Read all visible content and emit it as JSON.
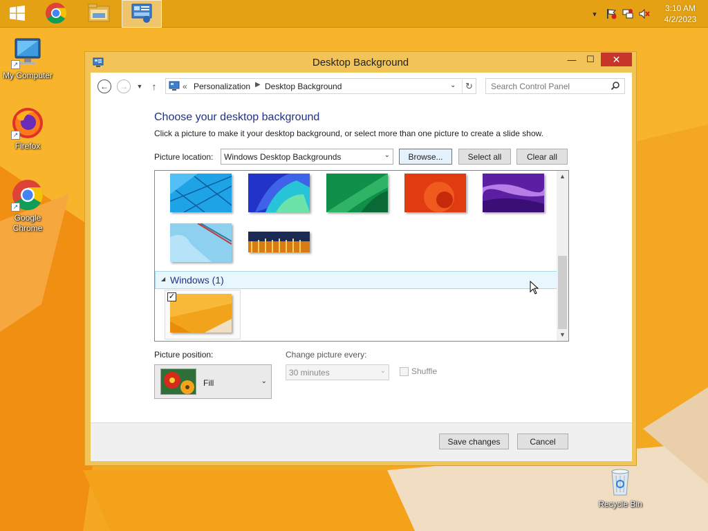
{
  "taskbar": {
    "items": [
      {
        "name": "start",
        "icon": "windows-logo-icon"
      },
      {
        "name": "chrome",
        "icon": "chrome-icon"
      },
      {
        "name": "file-explorer",
        "icon": "folder-icon"
      },
      {
        "name": "control-panel",
        "icon": "control-panel-icon",
        "active": true
      }
    ],
    "clock": {
      "time": "3:10 AM",
      "date": "4/2/2023"
    }
  },
  "desktop": {
    "icons": [
      {
        "label": "My Computer",
        "icon": "computer-icon"
      },
      {
        "label": "Firefox",
        "icon": "firefox-icon"
      },
      {
        "label": "Google Chrome",
        "icon": "chrome-icon"
      },
      {
        "label": "Recycle Bin",
        "icon": "recycle-bin-icon"
      }
    ]
  },
  "window": {
    "title": "Desktop Background",
    "address": {
      "prefix": "«",
      "crumbs": [
        "Personalization",
        "Desktop Background"
      ]
    },
    "search": {
      "placeholder": "Search Control Panel"
    },
    "heading": "Choose your desktop background",
    "subtext": "Click a picture to make it your desktop background, or select more than one picture to create a slide show.",
    "picture_location": {
      "label": "Picture location:",
      "value": "Windows Desktop Backgrounds"
    },
    "buttons": {
      "browse": "Browse...",
      "select_all": "Select all",
      "clear_all": "Clear all",
      "save": "Save changes",
      "cancel": "Cancel"
    },
    "group": {
      "label": "Windows (1)"
    },
    "picture_position": {
      "label": "Picture position:",
      "value": "Fill"
    },
    "change_picture": {
      "label": "Change picture every:",
      "value": "30 minutes"
    },
    "shuffle": {
      "label": "Shuffle",
      "checked": false
    }
  },
  "colors": {
    "accent": "#1e3287",
    "wallpaper": "#f2a31c",
    "close": "#c7342a"
  }
}
